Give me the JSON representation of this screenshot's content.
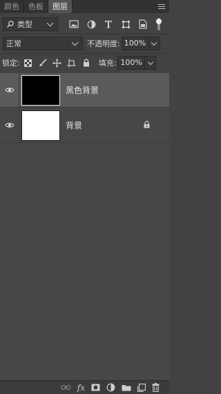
{
  "tabs": [
    {
      "label": "颜色",
      "active": false
    },
    {
      "label": "色板",
      "active": false
    },
    {
      "label": "图层",
      "active": true
    }
  ],
  "filter": {
    "kind_label": "类型",
    "icons": [
      "image-filter-icon",
      "adjustment-filter-icon",
      "type-filter-icon",
      "shape-filter-icon",
      "smart-object-filter-icon"
    ]
  },
  "blend": {
    "mode": "正常",
    "opacity_label": "不透明度:",
    "opacity_value": "100%"
  },
  "lock": {
    "label": "锁定:",
    "fill_label": "填充:",
    "fill_value": "100%"
  },
  "layers": [
    {
      "name": "黑色背景",
      "thumb_color": "#000000",
      "selected": true,
      "locked": false
    },
    {
      "name": "背景",
      "thumb_color": "#ffffff",
      "selected": false,
      "locked": true
    }
  ],
  "colors": {
    "panel_bg": "#424242",
    "selected_row": "#5a5a5a"
  }
}
